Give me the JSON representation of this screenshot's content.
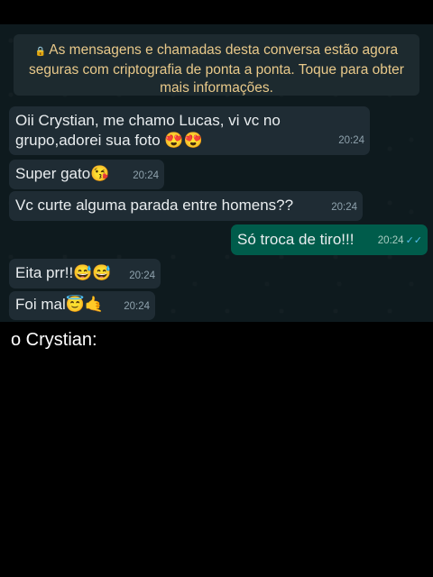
{
  "encryption_notice": "As mensagens e chamadas desta conversa estão agora seguras com criptografia de ponta a ponta. Toque para obter mais informações.",
  "messages": [
    {
      "direction": "in",
      "line1": "Oii Crystian, me chamo Lucas, vi vc no",
      "line2": "grupo,adorei sua foto 😍😍",
      "time": "20:24"
    },
    {
      "direction": "in",
      "text": "Super gato😘",
      "time": "20:24"
    },
    {
      "direction": "in",
      "text": "Vc curte alguma parada entre homens??",
      "time": "20:24"
    },
    {
      "direction": "out",
      "text": "Só troca de tiro!!!",
      "time": "20:24",
      "ticks": "✓✓"
    },
    {
      "direction": "in",
      "text": "Eita prr!!😅😅",
      "time": "20:24"
    },
    {
      "direction": "in",
      "text": "Foi mal😇🤙",
      "time": "20:24"
    }
  ],
  "caption": "o Crystian:",
  "colors": {
    "incoming_bubble": "#1f2c34",
    "outgoing_bubble": "#005c4b",
    "notice_text": "#e9c98a",
    "read_ticks": "#53bdeb"
  }
}
